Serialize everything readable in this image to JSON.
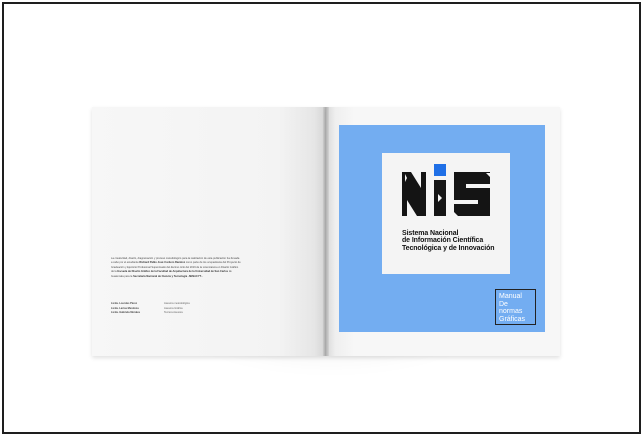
{
  "scene": "Open square brochure mockup on white background",
  "left_page": {
    "paragraph_1": "La creatividad, diseño, diagramación y proceso metodológico para la realización de esta publicación fue llevada a cabo por el estudiante",
    "paragraph_author": "Richard Pablo José Cordero Ramírez",
    "paragraph_2": "como parte de los ocupados/as del Proyecto de Graduación y Ejercicio Profesional Supervisado del décimo ciclo del 2019 de la Licenciatura en Diseño Gráfico de la",
    "paragraph_school": "Escuela de Diseño Gráfico de la Facultad de Arquitectura de la Universidad de San Carlos",
    "paragraph_3": "de Guatemala para la",
    "paragraph_client": "Secretaría Nacional de Ciencia y Tecnología -SENACYT-.",
    "credits": [
      {
        "name": "Licda. Lourdes Pérez",
        "role": "Asesora metodológica"
      },
      {
        "name": "Licda. Larisa Mendoza",
        "role": "Asesora Gráfica"
      },
      {
        "name": "Licda. Gabriela Morales",
        "role": "Tercera Asesora"
      }
    ]
  },
  "cover": {
    "org_name_line1": "Sistema Nacional",
    "org_name_line2": "de Información Científica",
    "org_name_line3": "Tecnológica y de Innovación",
    "title_line1": "Manual",
    "title_line2": "De normas",
    "title_line3": "Gráficas",
    "colors": {
      "cover_blue": "#73adf1",
      "logo_accent": "#1f6fe6",
      "logo_dark": "#141414"
    }
  }
}
